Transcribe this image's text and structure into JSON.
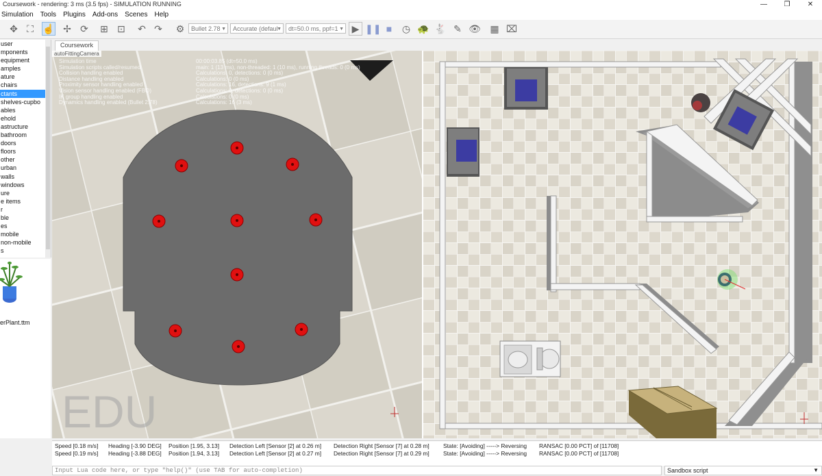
{
  "window": {
    "title": "Coursework - rendering: 3 ms (3.5 fps) - SIMULATION RUNNING",
    "controls": [
      "—",
      "❐",
      "✕"
    ]
  },
  "menu": [
    "Simulation",
    "Tools",
    "Plugins",
    "Add-ons",
    "Scenes",
    "Help"
  ],
  "toolbar": {
    "engine": "Bullet 2.78",
    "accuracy": "Accurate (defaul",
    "timestep": "dt=50.0 ms, ppf=1",
    "play_icon": "play-icon",
    "pause_icon": "pause-icon",
    "stop_icon": "stop-icon"
  },
  "hierarchy": {
    "items": [
      "user",
      "mponents",
      "equipment",
      "amples",
      "ature",
      "chairs",
      "ctants",
      "shelves-cupbo",
      "ables",
      "ehold",
      "astructure",
      "bathroom",
      "doors",
      "floors",
      "other",
      "urban",
      "walls",
      "windows",
      "ure",
      "e items",
      "r",
      "ble",
      "es",
      "mobile",
      "non-mobile",
      "s"
    ],
    "selected_index": 6
  },
  "model_preview": {
    "label": "erPlant.ttm"
  },
  "scene_tab": "Coursework",
  "left_view": {
    "camera_label": "autoFittingCamera",
    "watermark": "EDU",
    "info_rows": [
      {
        "label": "Simulation time",
        "value": "00:00:03.85 (dt=50.0 ms)"
      },
      {
        "label": "Simulation scripts called/resumed",
        "value": "main: 1 (13 ms), non-threaded: 1 (10 ms), running threads: 0 (0 ms)"
      },
      {
        "label": "Collision handling enabled",
        "value": "Calculations: 0, detections: 0 (0 ms)"
      },
      {
        "label": "Distance handling enabled",
        "value": "Calculations: 0 (0 ms)"
      },
      {
        "label": "Proximity sensor handling enabled",
        "value": "Calculations: 16, detections: 9 (1 ms)"
      },
      {
        "label": "Vision sensor handling enabled (FBO)",
        "value": "Calculations: 0, detections: 0 (0 ms)"
      },
      {
        "label": "IK group handling enabled",
        "value": "Calculations: 0 (0 ms)"
      },
      {
        "label": "Dynamics handling enabled (Bullet 2.78)",
        "value": "Calculations: 16 (3 ms)"
      }
    ]
  },
  "status_rows": [
    {
      "speed": "Speed [0.18 m/s]",
      "heading": "Heading [-3.90 DEG]",
      "position": "Position [1.95, 3.13]",
      "det_left": "Detection Left [Sensor [2] at 0.26 m]",
      "det_right": "Detection Right [Sensor [7] at 0.28 m]",
      "state": "State: [Avoiding] -----> Reversing",
      "ransac": "RANSAC [0.00 PCT] of [11708]"
    },
    {
      "speed": "Speed [0.19 m/s]",
      "heading": "Heading [-3.88 DEG]",
      "position": "Position [1.94, 3.13]",
      "det_left": "Detection Left [Sensor [2] at 0.27 m]",
      "det_right": "Detection Right [Sensor [7] at 0.29 m]",
      "state": "State: [Avoiding] -----> Reversing",
      "ransac": "RANSAC [0.00 PCT] of [11708]"
    }
  ],
  "lua_input": {
    "placeholder": "Input Lua code here, or type \"help()\" (use TAB for auto-completion)"
  },
  "script_mode": "Sandbox script",
  "colors": {
    "selection": "#3399ff",
    "sensor": "#e01010",
    "robot_body": "#6e6e6e",
    "box": "#9e8a4e",
    "cabinet": "#3a3aa0"
  }
}
